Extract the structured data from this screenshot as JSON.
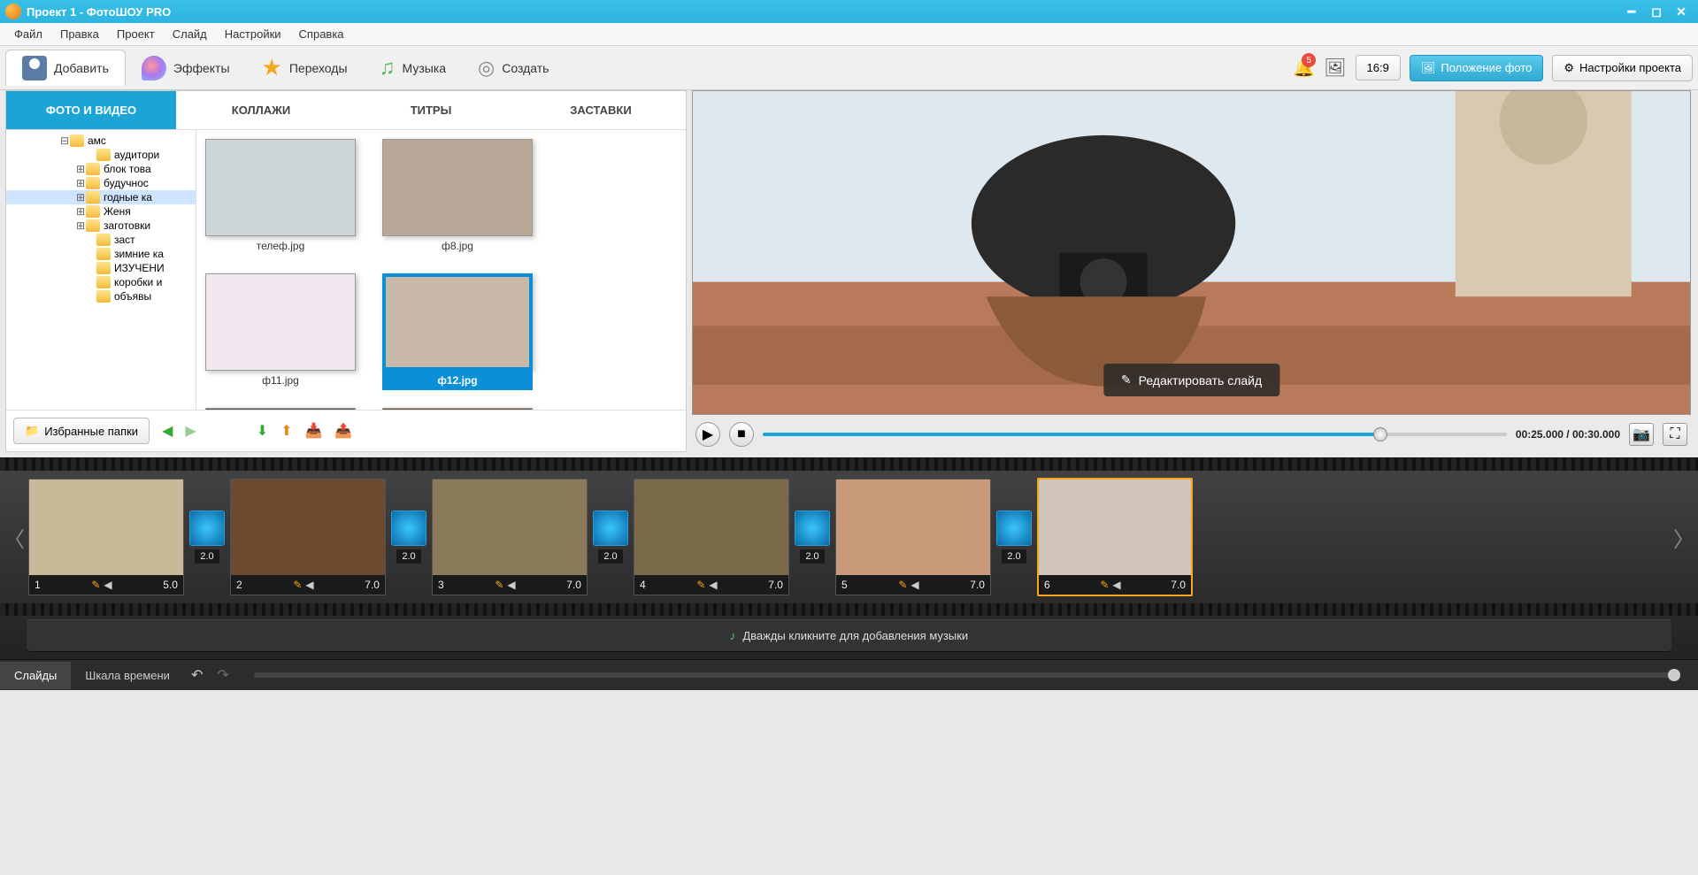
{
  "title": "Проект 1 - ФотоШОУ PRO",
  "menu": [
    "Файл",
    "Правка",
    "Проект",
    "Слайд",
    "Настройки",
    "Справка"
  ],
  "toptabs": {
    "add": "Добавить",
    "effects": "Эффекты",
    "transitions": "Переходы",
    "music": "Музыка",
    "create": "Создать"
  },
  "notify_count": "5",
  "aspect": "16:9",
  "photo_pos": "Положение фото",
  "proj_settings": "Настройки проекта",
  "subtabs": [
    "ФОТО И ВИДЕО",
    "КОЛЛАЖИ",
    "ТИТРЫ",
    "ЗАСТАВКИ"
  ],
  "tree": [
    {
      "pad": 60,
      "exp": "⊟",
      "label": "амс",
      "sel": false
    },
    {
      "pad": 90,
      "exp": "",
      "label": "аудитори",
      "sel": false
    },
    {
      "pad": 78,
      "exp": "⊞",
      "label": "блок това",
      "sel": false
    },
    {
      "pad": 78,
      "exp": "⊞",
      "label": "будучнос",
      "sel": false
    },
    {
      "pad": 78,
      "exp": "⊞",
      "label": "годные ка",
      "sel": true
    },
    {
      "pad": 78,
      "exp": "⊞",
      "label": "Женя",
      "sel": false
    },
    {
      "pad": 78,
      "exp": "⊞",
      "label": "заготовки",
      "sel": false
    },
    {
      "pad": 90,
      "exp": "",
      "label": "заст",
      "sel": false
    },
    {
      "pad": 90,
      "exp": "",
      "label": "зимние ка",
      "sel": false
    },
    {
      "pad": 90,
      "exp": "",
      "label": "ИЗУЧЕНИ",
      "sel": false
    },
    {
      "pad": 90,
      "exp": "",
      "label": "коробки и",
      "sel": false
    },
    {
      "pad": 90,
      "exp": "",
      "label": "объявы",
      "sel": false
    }
  ],
  "thumbs": [
    {
      "label": "телеф.jpg",
      "sel": false,
      "bg": "#cfd6da"
    },
    {
      "label": "ф8.jpg",
      "sel": false,
      "bg": "#b9a898"
    },
    {
      "label": "ф11.jpg",
      "sel": false,
      "bg": "#f0e8ee"
    },
    {
      "label": "ф12.jpg",
      "sel": true,
      "bg": "#c9b9a8"
    },
    {
      "label": "",
      "sel": false,
      "bg": "#555"
    },
    {
      "label": "",
      "sel": false,
      "bg": "#6b5a48"
    }
  ],
  "fav_label": "Избранные папки",
  "edit_slide": "Редактировать слайд",
  "time_cur": "00:25.000",
  "time_tot": "00:30.000",
  "progress_pct": 83,
  "slides": [
    {
      "n": "1",
      "dur": "5.0",
      "bg": "#c9b998"
    },
    {
      "n": "2",
      "dur": "7.0",
      "bg": "#6b4a2f"
    },
    {
      "n": "3",
      "dur": "7.0",
      "bg": "#8a7a5a"
    },
    {
      "n": "4",
      "dur": "7.0",
      "bg": "#7a6a4a"
    },
    {
      "n": "5",
      "dur": "7.0",
      "bg": "#c99a7a"
    },
    {
      "n": "6",
      "dur": "7.0",
      "bg": "#d0c4b8"
    }
  ],
  "trans_dur": "2.0",
  "music_hint": "Дважды кликните для добавления музыки",
  "bottom": {
    "slides": "Слайды",
    "timeline": "Шкала времени"
  }
}
